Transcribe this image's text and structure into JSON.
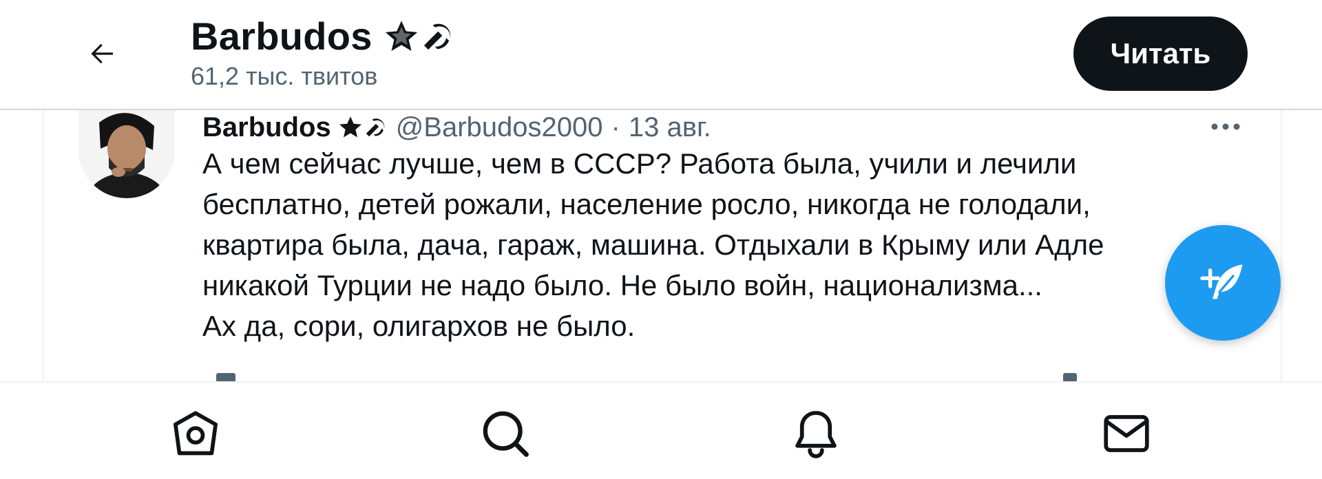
{
  "header": {
    "title": "Barbudos",
    "title_emoji": "★☭",
    "subtitle": "61,2 тыс. твитов",
    "follow_label": "Читать",
    "back_icon": "arrow-left-icon"
  },
  "tweet": {
    "author_name": "Barbudos",
    "author_emoji": "★☭",
    "handle": "@Barbudos2000",
    "separator": "·",
    "date": "13 авг.",
    "more_icon": "more-icon",
    "text_lines": [
      "А чем сейчас лучше, чем в СССР? Работа была, учили и лечили",
      "бесплатно, детей рожали, население росло, никогда не голодали,",
      "квартира была, дача, гараж, машина. Отдыхали в Крыму или Адле",
      "никакой Турции не надо было. Не было войн, национализма...",
      "Ах да, сори, олигархов не было."
    ]
  },
  "fab": {
    "icon": "compose-tweet-icon"
  },
  "bottom_nav": [
    {
      "name": "home",
      "icon": "home-icon"
    },
    {
      "name": "search",
      "icon": "search-icon"
    },
    {
      "name": "notifications",
      "icon": "bell-icon"
    },
    {
      "name": "messages",
      "icon": "mail-icon"
    }
  ],
  "colors": {
    "primary_text": "#0f1419",
    "secondary_text": "#536471",
    "accent": "#1d9bf0",
    "follow_bg": "#0f1419",
    "divider": "#cfd9de"
  }
}
